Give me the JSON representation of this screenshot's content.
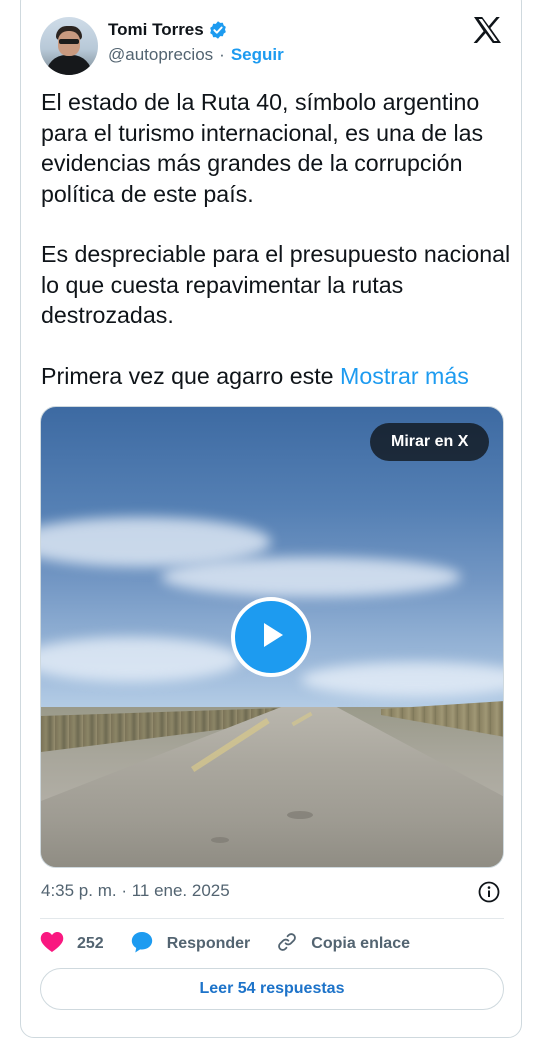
{
  "author": {
    "name": "Tomi Torres",
    "handle": "@autoprecios",
    "follow_label": "Seguir",
    "separator": "·"
  },
  "tweet": {
    "paragraphs": [
      "El estado de la Ruta 40, símbolo argentino para el turismo internacional, es una de las evidencias más grandes de la corrupción política de este país.",
      "Es despreciable para el presupuesto nacional lo que cuesta repavimentar la rutas destrozadas."
    ],
    "truncated_text": "Primera vez que agarro este",
    "show_more_label": "Mostrar más"
  },
  "media": {
    "watch_on_x_label": "Mirar en X"
  },
  "meta": {
    "timestamp": "4:35 p. m. · 11 ene. 2025"
  },
  "actions": {
    "like_count": "252",
    "reply_label": "Responder",
    "copy_link_label": "Copia enlace"
  },
  "footer": {
    "read_replies_label": "Leer 54 respuestas"
  },
  "colors": {
    "accent": "#1d9bf0",
    "like": "#f91880",
    "text": "#0f1419",
    "secondary": "#536471"
  },
  "icons": [
    "verified-badge-icon",
    "x-logo-icon",
    "play-icon",
    "info-icon",
    "heart-icon",
    "reply-bubble-icon",
    "link-icon"
  ]
}
